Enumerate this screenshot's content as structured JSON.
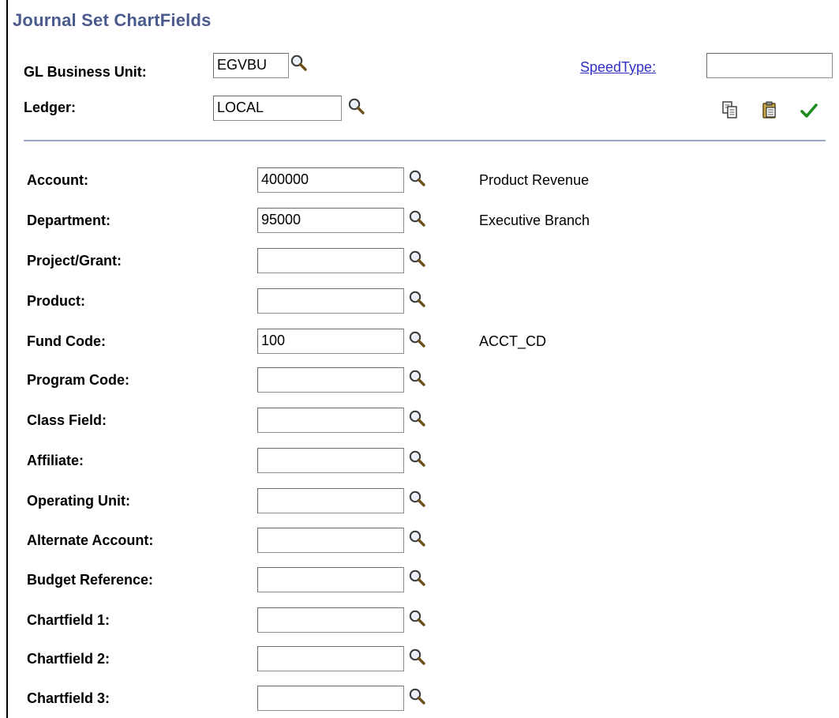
{
  "title": "Journal Set ChartFields",
  "header": {
    "business_unit_label": "GL Business Unit:",
    "business_unit_value": "EGVBU",
    "ledger_label": "Ledger:",
    "ledger_value": "LOCAL",
    "speedtype_label": "SpeedType:",
    "speedtype_value": ""
  },
  "toolbar": {
    "icons": [
      "copy-icon",
      "paste-icon",
      "check-icon"
    ]
  },
  "rows": [
    {
      "label": "Account:",
      "value": "400000",
      "description": "Product Revenue"
    },
    {
      "label": "Department:",
      "value": "95000",
      "description": "Executive Branch"
    },
    {
      "label": "Project/Grant:",
      "value": "",
      "description": ""
    },
    {
      "label": "Product:",
      "value": "",
      "description": ""
    },
    {
      "label": "Fund Code:",
      "value": "100",
      "description": "ACCT_CD"
    },
    {
      "label": "Program Code:",
      "value": "",
      "description": ""
    },
    {
      "label": "Class Field:",
      "value": "",
      "description": ""
    },
    {
      "label": "Affiliate:",
      "value": "",
      "description": ""
    },
    {
      "label": "Operating Unit:",
      "value": "",
      "description": ""
    },
    {
      "label": "Alternate Account:",
      "value": "",
      "description": ""
    },
    {
      "label": "Budget Reference:",
      "value": "",
      "description": ""
    },
    {
      "label": "Chartfield 1:",
      "value": "",
      "description": ""
    },
    {
      "label": "Chartfield 2:",
      "value": "",
      "description": ""
    },
    {
      "label": "Chartfield 3:",
      "value": "",
      "description": ""
    }
  ],
  "colors": {
    "title": "#4a5a8c",
    "link": "#3030c8",
    "divider": "#9aa6c8",
    "check": "#1e8c1e"
  }
}
